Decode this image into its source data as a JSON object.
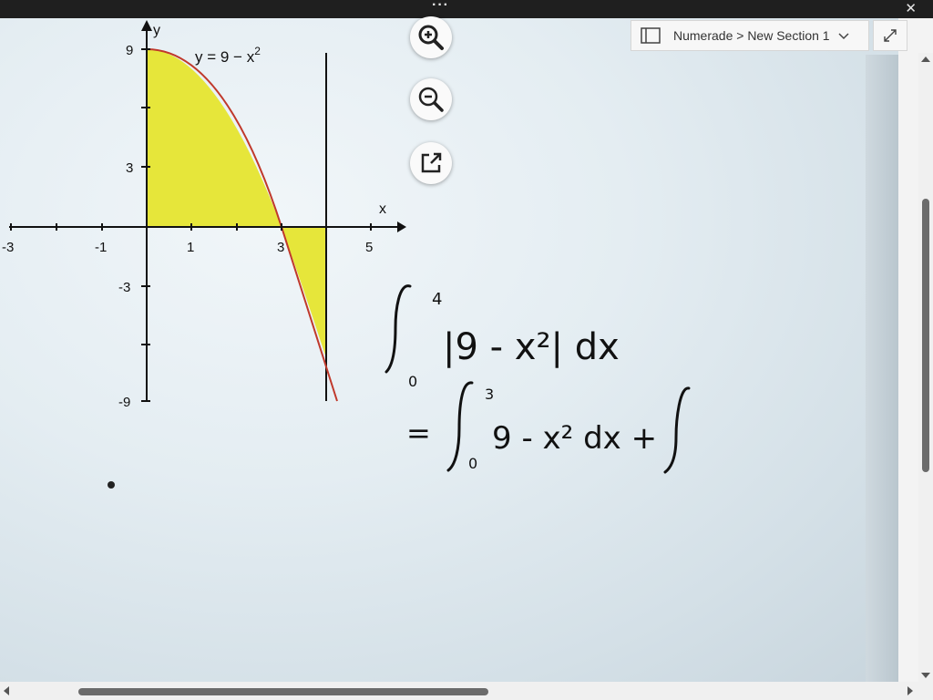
{
  "window": {
    "more_label": "···",
    "close_label": "✕"
  },
  "breadcrumb": {
    "text": "Numerade > New Section 1"
  },
  "icons": {
    "zoom_in": "zoom-in-icon",
    "zoom_out": "zoom-out-icon",
    "open_external": "open-external-icon",
    "notebook": "notebook-icon",
    "chevron": "chevron-down-icon",
    "expand": "expand-icon"
  },
  "graph": {
    "equation": "y = 9 − x",
    "equation_exp": "2",
    "y_axis_label": "y",
    "x_axis_label": "x",
    "x_ticks": [
      "-3",
      "-1",
      "1",
      "3",
      "5"
    ],
    "y_ticks": [
      "9",
      "3",
      "-3",
      "-9"
    ],
    "fill_color": "#e6e63a",
    "curve_color": "#c0392b"
  },
  "handwriting": {
    "line1_upper": "4",
    "line1_lower": "0",
    "line1_body": "|9 - x²| dx",
    "line2_prefix": "=",
    "line2_upper": "3",
    "line2_lower": "0",
    "line2_body": "9 - x² dx  +"
  },
  "colors": {
    "titlebar": "#1f1f1f",
    "scroll_thumb": "#6b6b6b"
  }
}
